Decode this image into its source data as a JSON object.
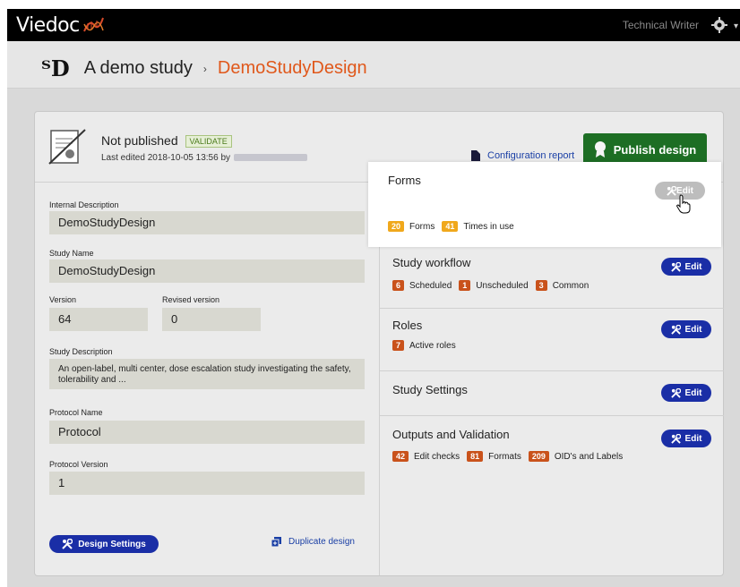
{
  "topbar": {
    "app_name": "Viedoc",
    "user": "Technical Writer"
  },
  "breadcrumb": {
    "study": "A demo study",
    "separator": "›",
    "design": "DemoStudyDesign"
  },
  "status": {
    "publish_state": "Not published",
    "validate_label": "VALIDATE",
    "last_edited": "Last edited 2018-10-05 13:56 by",
    "config_report": "Configuration report",
    "publish_button": "Publish design"
  },
  "details": {
    "internal_description_label": "Internal Description",
    "internal_description": "DemoStudyDesign",
    "study_name_label": "Study Name",
    "study_name": "DemoStudyDesign",
    "version_label": "Version",
    "version": "64",
    "revised_version_label": "Revised version",
    "revised_version": "0",
    "study_description_label": "Study Description",
    "study_description": "An open-label, multi center, dose escalation study investigating the safety, tolerability and ...",
    "protocol_name_label": "Protocol Name",
    "protocol_name": "Protocol",
    "protocol_version_label": "Protocol Version",
    "protocol_version": "1",
    "design_settings_button": "Design Settings",
    "duplicate_link": "Duplicate design"
  },
  "sections": {
    "edit_label": "Edit",
    "forms": {
      "title": "Forms",
      "count1": "20",
      "label1": "Forms",
      "count2": "41",
      "label2": "Times in use"
    },
    "workflow": {
      "title": "Study workflow",
      "count1": "6",
      "label1": "Scheduled",
      "count2": "1",
      "label2": "Unscheduled",
      "count3": "3",
      "label3": "Common"
    },
    "roles": {
      "title": "Roles",
      "count1": "7",
      "label1": "Active roles"
    },
    "settings": {
      "title": "Study Settings"
    },
    "outputs": {
      "title": "Outputs and Validation",
      "count1": "42",
      "label1": "Edit checks",
      "count2": "81",
      "label2": "Formats",
      "count3": "209",
      "label3": "OID's and Labels"
    }
  },
  "colors": {
    "accent_orange": "#e0581b",
    "primary_blue": "#1a2ea6",
    "publish_green": "#1d6e24",
    "badge_orange": "#c9521b",
    "badge_yellow": "#f0a81c"
  }
}
